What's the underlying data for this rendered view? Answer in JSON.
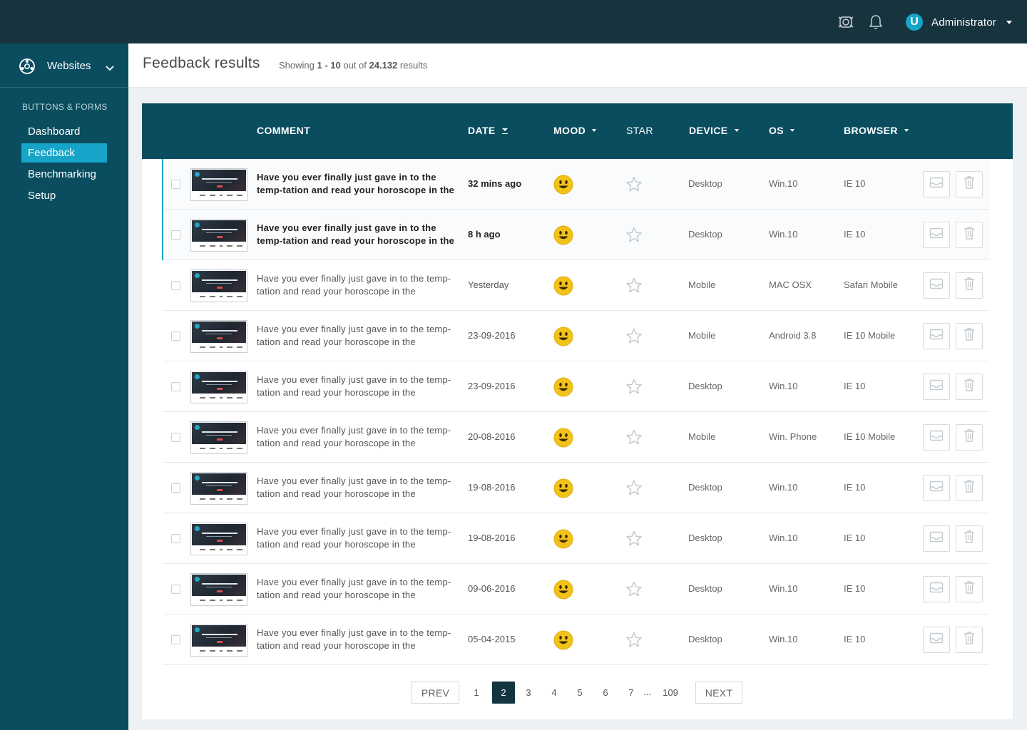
{
  "topbar": {
    "user_initial": "U",
    "user_name": "Administrator"
  },
  "sidebar": {
    "site_label": "Websites",
    "section_title": "BUTTONS & FORMS",
    "items": [
      {
        "label": "Dashboard"
      },
      {
        "label": "Feedback"
      },
      {
        "label": "Benchmarking"
      },
      {
        "label": "Setup"
      }
    ]
  },
  "header": {
    "title": "Feedback results",
    "showing_prefix": "Showing",
    "range": "1 - 10",
    "out_of": "out of",
    "total": "24.132",
    "suffix": "results"
  },
  "table": {
    "columns": {
      "comment": "COMMENT",
      "date": "DATE",
      "mood": "MOOD",
      "star": "STAR",
      "device": "DEVICE",
      "os": "OS",
      "browser": "BROWSER"
    },
    "rows": [
      {
        "comment": "Have you ever finally just gave in to the temp-tation and read your horoscope in the",
        "date": "32 mins ago",
        "device": "Desktop",
        "os": "Win.10",
        "browser": "IE 10"
      },
      {
        "comment": "Have you ever finally just gave in to the temp-tation and read your horoscope in the",
        "date": "8 h ago",
        "device": "Desktop",
        "os": "Win.10",
        "browser": "IE 10"
      },
      {
        "comment": "Have you ever finally just gave in to the temp-tation and read your horoscope in the",
        "date": "Yesterday",
        "device": "Mobile",
        "os": "MAC OSX",
        "browser": "Safari Mobile"
      },
      {
        "comment": "Have you ever finally just gave in to the temp-tation and read your horoscope in the",
        "date": "23-09-2016",
        "device": "Mobile",
        "os": "Android 3.8",
        "browser": "IE 10 Mobile"
      },
      {
        "comment": "Have you ever finally just gave in to the temp-tation and read your horoscope in the",
        "date": "23-09-2016",
        "device": "Desktop",
        "os": "Win.10",
        "browser": "IE 10"
      },
      {
        "comment": "Have you ever finally just gave in to the temp-tation and read your horoscope in the",
        "date": "20-08-2016",
        "device": "Mobile",
        "os": "Win. Phone",
        "browser": "IE 10 Mobile"
      },
      {
        "comment": "Have you ever finally just gave in to the temp-tation and read your horoscope in the",
        "date": "19-08-2016",
        "device": "Desktop",
        "os": "Win.10",
        "browser": "IE 10"
      },
      {
        "comment": "Have you ever finally just gave in to the temp-tation and read your horoscope in the",
        "date": "19-08-2016",
        "device": "Desktop",
        "os": "Win.10",
        "browser": "IE 10"
      },
      {
        "comment": "Have you ever finally just gave in to the temp-tation and read your horoscope in the",
        "date": "09-06-2016",
        "device": "Desktop",
        "os": "Win.10",
        "browser": "IE 10"
      },
      {
        "comment": "Have you ever finally just gave in to the temp-tation and read your horoscope in the",
        "date": "05-04-2015",
        "device": "Desktop",
        "os": "Win.10",
        "browser": "IE 10"
      }
    ]
  },
  "pagination": {
    "prev": "PREV",
    "next": "NEXT",
    "pages": [
      "1",
      "2",
      "3",
      "4",
      "5",
      "6",
      "7"
    ],
    "ellipsis": "...",
    "last": "109",
    "current": "2"
  },
  "colors": {
    "topbar": "#17333d",
    "sidebar": "#094d5f",
    "accent": "#16a4c9",
    "mood": "#f2c21b"
  }
}
